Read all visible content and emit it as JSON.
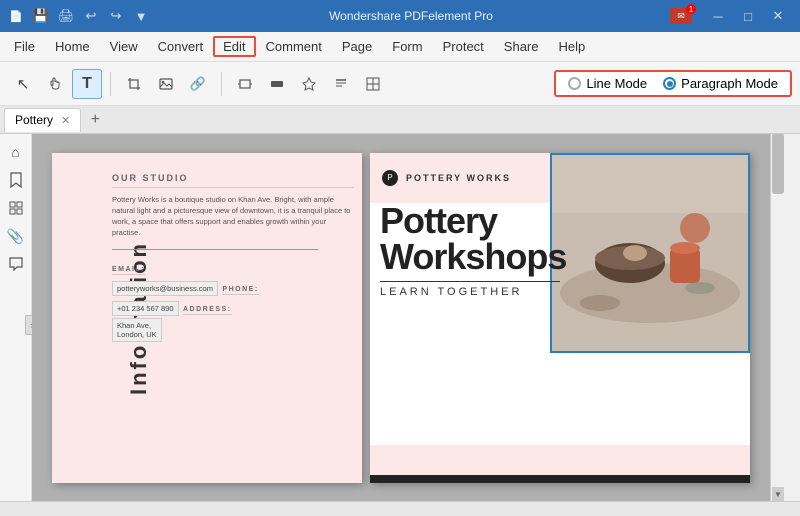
{
  "app": {
    "title": "Wondershare PDFelement Pro",
    "email_badge": "1"
  },
  "titlebar": {
    "controls": {
      "minimize": "─",
      "maximize": "□",
      "close": "✕"
    },
    "quickaccess": [
      "💾",
      "🖨",
      "↩",
      "↪",
      "▼"
    ]
  },
  "menubar": {
    "items": [
      {
        "id": "file",
        "label": "File"
      },
      {
        "id": "home",
        "label": "Home"
      },
      {
        "id": "view",
        "label": "View"
      },
      {
        "id": "convert",
        "label": "Convert"
      },
      {
        "id": "edit",
        "label": "Edit"
      },
      {
        "id": "comment",
        "label": "Comment"
      },
      {
        "id": "page",
        "label": "Page"
      },
      {
        "id": "form",
        "label": "Form"
      },
      {
        "id": "protect",
        "label": "Protect"
      },
      {
        "id": "share",
        "label": "Share"
      },
      {
        "id": "help",
        "label": "Help"
      }
    ]
  },
  "toolbar": {
    "buttons": [
      {
        "id": "select",
        "icon": "↖",
        "tooltip": "Select"
      },
      {
        "id": "hand",
        "icon": "✋",
        "tooltip": "Hand"
      },
      {
        "id": "edit-text",
        "icon": "T",
        "tooltip": "Edit Text",
        "active": true
      },
      {
        "id": "crop",
        "icon": "⊡",
        "tooltip": "Crop"
      },
      {
        "id": "image",
        "icon": "🖼",
        "tooltip": "Image"
      },
      {
        "id": "link",
        "icon": "🔗",
        "tooltip": "Link"
      },
      {
        "id": "sep1",
        "type": "separator"
      },
      {
        "id": "rect",
        "icon": "▭",
        "tooltip": "Rectangle"
      },
      {
        "id": "redact",
        "icon": "▪",
        "tooltip": "Redact"
      },
      {
        "id": "watermark",
        "icon": "◇",
        "tooltip": "Watermark"
      },
      {
        "id": "header",
        "icon": "≡",
        "tooltip": "Header"
      },
      {
        "id": "bates",
        "icon": "⊞",
        "tooltip": "Bates"
      }
    ],
    "mode_selector": {
      "label": "",
      "options": [
        {
          "id": "line",
          "label": "Line Mode",
          "selected": false
        },
        {
          "id": "paragraph",
          "label": "Paragraph Mode",
          "selected": true
        }
      ]
    }
  },
  "tabs": {
    "items": [
      {
        "id": "pottery",
        "label": "Pottery",
        "active": true
      }
    ],
    "new_tab_label": "+"
  },
  "sidebar": {
    "icons": [
      {
        "id": "home",
        "icon": "⌂"
      },
      {
        "id": "bookmark",
        "icon": "🔖"
      },
      {
        "id": "thumbnail",
        "icon": "⊞"
      },
      {
        "id": "attachment",
        "icon": "📎"
      },
      {
        "id": "comment",
        "icon": "💬"
      }
    ],
    "expand_arrow": "›"
  },
  "document": {
    "left_page": {
      "vertical_text": "Information",
      "section_heading": "OUR STUDIO",
      "body_text": "Pottery Works is a boutique studio on Khan Ave. Bright, with ample natural light and a picturesque view of downtown, it is a tranquil place to work, a space that offers support and enables growth within your practise.",
      "email_label": "EMAIL:",
      "email_value": "potteryworks@business.com",
      "phone_label": "PHONE:",
      "phone_value": "+01 234 567 890",
      "address_label": "ADDRESS:",
      "address_value": "Khan Ave,\nLondon, UK"
    },
    "right_page": {
      "logo_text": "P",
      "brand_name": "POTTERY WORKS",
      "heading_line1": "Pottery",
      "heading_line2": "Workshops",
      "subheading": "LEARN TOGETHER"
    }
  },
  "statusbar": {
    "text": ""
  }
}
